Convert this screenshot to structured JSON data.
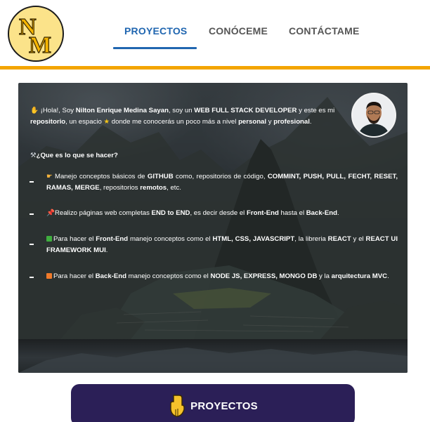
{
  "logo": {
    "text": "NM"
  },
  "nav": {
    "items": [
      {
        "label": "PROYECTOS",
        "active": true
      },
      {
        "label": "CONÓCEME",
        "active": false
      },
      {
        "label": "CONTÁCTAME",
        "active": false
      }
    ]
  },
  "colors": {
    "accent_bar": "#f3a500",
    "nav_active": "#2066b0",
    "button_bg": "#2b1f57"
  },
  "hero": {
    "intro": {
      "p1": "¡Hola!, Soy ",
      "name": "Nilton Enrique Medina Sayan",
      "p2": ", soy un ",
      "role": "WEB FULL STACK DEVELOPER",
      "p3": " y este es mi ",
      "repo": "repositorio",
      "p4": ", un espacio ",
      "p5": " donde me conocerás un poco más a nivel ",
      "personal": "personal",
      "p6": " y ",
      "profesional": "profesional",
      "p7": "."
    },
    "question": "¿Que es lo que se hacer?",
    "items": [
      {
        "t1": "Manejo conceptos básicos de ",
        "b1": "GITHUB",
        "t2": " como, repositorios de código, ",
        "b2": "COMMINT, PUSH, PULL, FECHT, RESET, RAMAS, MERGE",
        "t3": ", repositorios ",
        "b3": "remotos",
        "t4": ", etc."
      },
      {
        "t1": "Realizo páginas web completas ",
        "b1": "END to END",
        "t2": ", es decir desde el ",
        "b2": "Front-End",
        "t3": " hasta el ",
        "b3": "Back-End",
        "t4": "."
      },
      {
        "t1": "Para hacer el ",
        "b1": "Front-End",
        "t2": " manejo conceptos como el ",
        "b2": "HTML, CSS, JAVASCRIPT",
        "t3": ", la libreria ",
        "b3": "REACT",
        "t4": " y el ",
        "b4": "REACT UI FRAMEWORK MUI",
        "t5": "."
      },
      {
        "t1": "Para hacer el ",
        "b1": "Back-End",
        "t2": " manejo conceptos como el ",
        "b2": "NODE JS, EXPRESS, MONGO DB",
        "t3": " y la ",
        "b3": "arquitectura MVC",
        "t4": "."
      }
    ]
  },
  "button": {
    "label": "PROYECTOS",
    "icon": "pointing-down-hand-icon"
  }
}
